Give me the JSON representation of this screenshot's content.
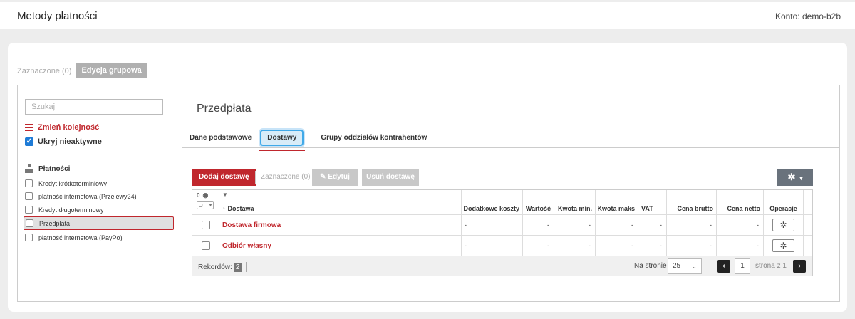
{
  "header": {
    "title": "Metody płatności",
    "account": "Konto: demo-b2b"
  },
  "bulk": {
    "selected": "Zaznaczone (0)",
    "group_edit": "Edycja grupowa"
  },
  "sidebar": {
    "search_placeholder": "Szukaj",
    "reorder": "Zmień kolejność",
    "hide_inactive": "Ukryj nieaktywne",
    "group_title": "Płatności",
    "items": [
      {
        "label": "Kredyt krótkoterminiowy"
      },
      {
        "label": "płatność internetowa (Przelewy24)"
      },
      {
        "label": "Kredyt długoterminowy"
      },
      {
        "label": "Przedpłata"
      },
      {
        "label": "płatność internetowa (PayPo)"
      }
    ]
  },
  "detail": {
    "title": "Przedpłata",
    "tabs": [
      {
        "label": "Dane podstawowe"
      },
      {
        "label": "Dostawy"
      },
      {
        "label": "Grupy oddziałów kontrahentów"
      }
    ]
  },
  "toolbar": {
    "add": "Dodaj dostawę",
    "selected": "Zaznaczone (0)",
    "edit": "Edytuj",
    "delete": "Usuń dostawę",
    "gear": "✲",
    "caret": "▾"
  },
  "table": {
    "mini_count": "0",
    "mini_box": "▾",
    "columns": {
      "name": "Dostawa",
      "extra": "Dodatkowe koszty",
      "value": "Wartość",
      "min": "Kwota min.",
      "max": "Kwota maks",
      "vat": "VAT",
      "gross": "Cena brutto",
      "net": "Cena netto",
      "ops": "Operacje"
    },
    "rows": [
      {
        "name": "Dostawa firmowa",
        "extra": "-",
        "value": "-",
        "min": "-",
        "max": "-",
        "vat": "-",
        "gross": "-",
        "net": "-"
      },
      {
        "name": "Odbiór własny",
        "extra": "-",
        "value": "-",
        "min": "-",
        "max": "-",
        "vat": "-",
        "gross": "-",
        "net": "-"
      }
    ]
  },
  "footer": {
    "records_label": "Rekordów:",
    "records_count": "2",
    "per_page_label": "Na stronie",
    "per_page_value": "25",
    "page": "1",
    "page_of": "strona z 1"
  }
}
